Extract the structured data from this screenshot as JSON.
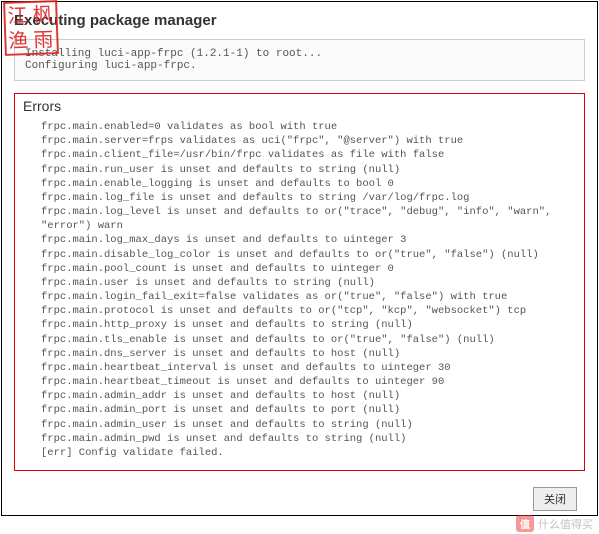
{
  "stamp": {
    "c1": "江",
    "c2": "枫",
    "c3": "渔",
    "c4": "雨"
  },
  "page": {
    "title": "Executing package manager"
  },
  "install": {
    "text": "Installing luci-app-frpc (1.2.1-1) to root...\nConfiguring luci-app-frpc."
  },
  "errors": {
    "title": "Errors",
    "lines": [
      "frpc.main.enabled=0 validates as bool with true",
      "frpc.main.server=frps validates as uci(\"frpc\", \"@server\") with true",
      "frpc.main.client_file=/usr/bin/frpc validates as file with false",
      "frpc.main.run_user is unset and defaults to string (null)",
      "frpc.main.enable_logging is unset and defaults to bool 0",
      "frpc.main.log_file is unset and defaults to string /var/log/frpc.log",
      "frpc.main.log_level is unset and defaults to or(\"trace\", \"debug\", \"info\", \"warn\", \"error\") warn",
      "frpc.main.log_max_days is unset and defaults to uinteger 3",
      "frpc.main.disable_log_color is unset and defaults to or(\"true\", \"false\") (null)",
      "frpc.main.pool_count is unset and defaults to uinteger 0",
      "frpc.main.user is unset and defaults to string (null)",
      "frpc.main.login_fail_exit=false validates as or(\"true\", \"false\") with true",
      "frpc.main.protocol is unset and defaults to or(\"tcp\", \"kcp\", \"websocket\") tcp",
      "frpc.main.http_proxy is unset and defaults to string (null)",
      "frpc.main.tls_enable is unset and defaults to or(\"true\", \"false\") (null)",
      "frpc.main.dns_server is unset and defaults to host (null)",
      "frpc.main.heartbeat_interval is unset and defaults to uinteger 30",
      "frpc.main.heartbeat_timeout is unset and defaults to uinteger 90",
      "frpc.main.admin_addr is unset and defaults to host (null)",
      "frpc.main.admin_port is unset and defaults to port (null)",
      "frpc.main.admin_user is unset and defaults to string (null)",
      "frpc.main.admin_pwd is unset and defaults to string (null)",
      "[err] Config validate failed."
    ]
  },
  "button": {
    "close": "关闭"
  },
  "watermark": {
    "badge": "值",
    "text": "什么值得买"
  }
}
